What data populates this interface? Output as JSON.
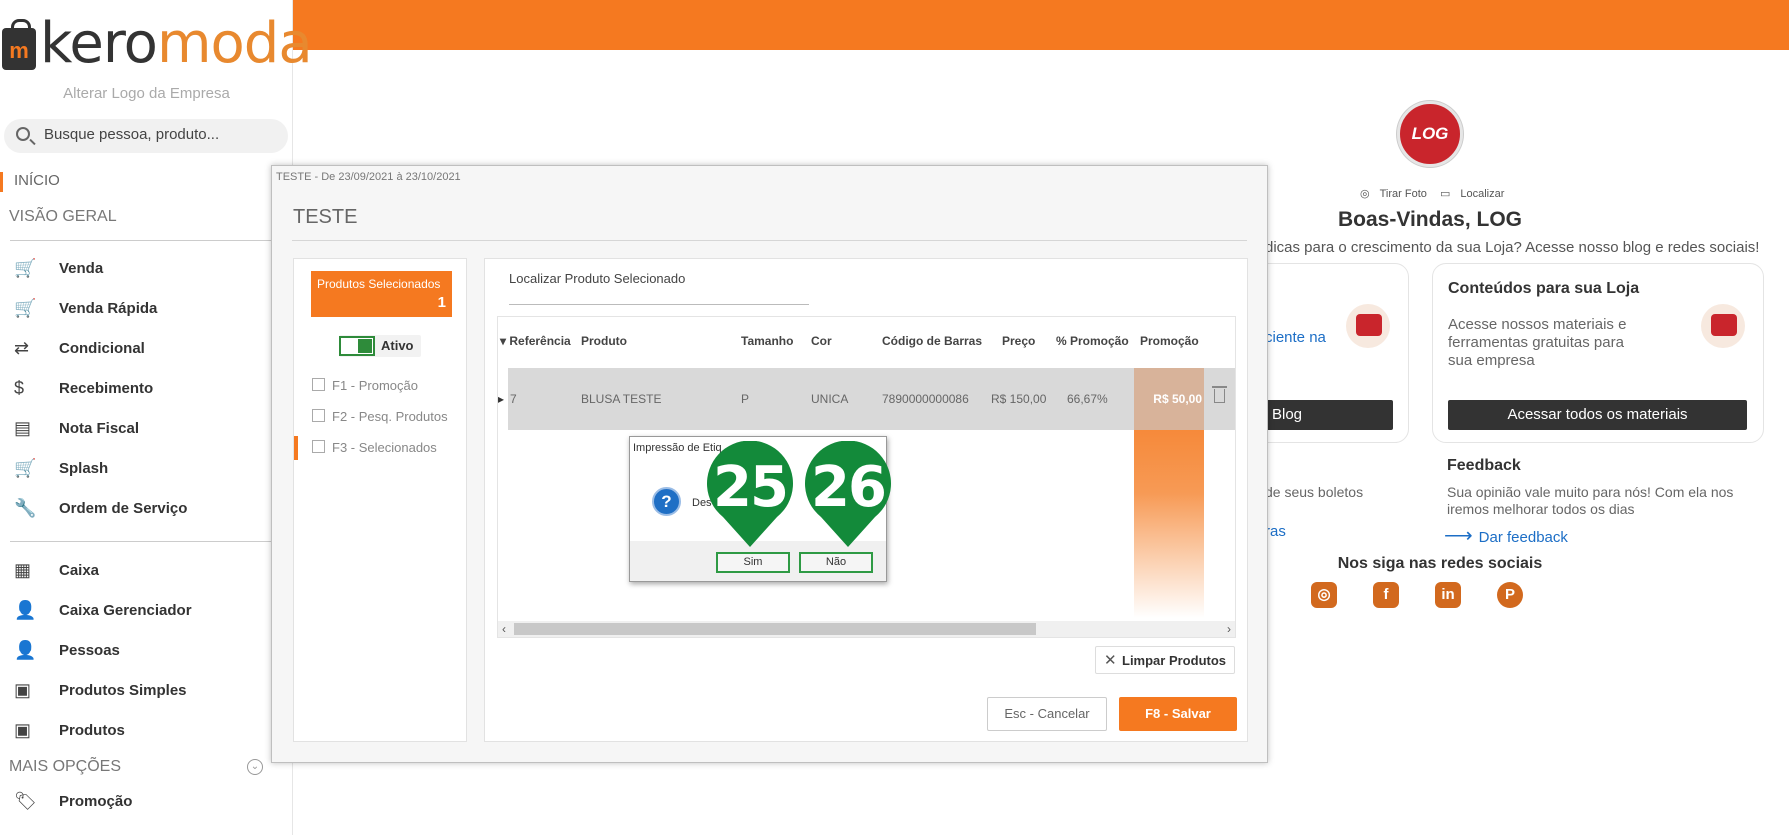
{
  "brand": {
    "logo_part1": "kero",
    "logo_part2": "moda",
    "logo_icon_letter": "m",
    "alterar_logo": "Alterar Logo da Empresa"
  },
  "search": {
    "placeholder": "Busque pessoa, produto..."
  },
  "sidebar": {
    "inicio": "INÍCIO",
    "visao_geral": "VISÃO GERAL",
    "items_main": [
      {
        "label": "Venda",
        "icon": "cart-icon"
      },
      {
        "label": "Venda Rápida",
        "icon": "cart-fast-icon"
      },
      {
        "label": "Condicional",
        "icon": "exchange-icon"
      },
      {
        "label": "Recebimento",
        "icon": "hand-money-icon"
      },
      {
        "label": "Nota Fiscal",
        "icon": "nfe-icon"
      },
      {
        "label": "Splash",
        "icon": "cart-dollar-icon"
      },
      {
        "label": "Ordem de Serviço",
        "icon": "wrench-icon"
      }
    ],
    "items_secondary": [
      {
        "label": "Caixa",
        "icon": "cash-register-icon"
      },
      {
        "label": "Caixa Gerenciador",
        "icon": "user-settings-icon"
      },
      {
        "label": "Pessoas",
        "icon": "people-icon"
      },
      {
        "label": "Produtos Simples",
        "icon": "box-icon"
      },
      {
        "label": "Produtos",
        "icon": "boxes-icon"
      }
    ],
    "mais_opcoes": "MAIS OPÇÕES",
    "promocao": "Promoção"
  },
  "welcome": {
    "avatar_text": "LOG",
    "tirar_foto": "Tirar Foto",
    "localizar": "Localizar",
    "title": "Boas-Vindas, LOG",
    "tagline": "dicas para o crescimento da sua Loja? Acesse nosso blog e redes sociais!",
    "card1_partial": "ciente na",
    "card1_btn": "Blog",
    "card2_title": "Conteúdos para sua Loja",
    "card2_desc": "Acesse nossos materiais e ferramentas gratuitas para sua empresa",
    "card2_btn": "Acessar todos os materiais",
    "boletos_partial": "de seus boletos",
    "ras_partial": "ras",
    "feedback_title": "Feedback",
    "feedback_desc": "Sua opinião vale muito para nós! Com ela nos iremos melhorar todos os dias",
    "feedback_link": "Dar feedback",
    "social_title": "Nos siga nas redes sociais"
  },
  "modal": {
    "window_title": "TESTE - De 23/09/2021 à 23/10/2021",
    "title": "TESTE",
    "produtos_selecionados_label": "Produtos Selecionados",
    "produtos_selecionados_count": "1",
    "toggle_label": "Ativo",
    "nav": [
      "F1 - Promoção",
      "F2 - Pesq. Produtos",
      "F3 - Selecionados"
    ],
    "localizar_label": "Localizar Produto Selecionado",
    "columns": [
      "Referência",
      "Produto",
      "Tamanho",
      "Cor",
      "Código de Barras",
      "Preço",
      "% Promoção",
      "Promoção"
    ],
    "row": {
      "referencia": "7",
      "produto": "BLUSA TESTE",
      "tamanho": "P",
      "cor": "UNICA",
      "codigo": "7890000000086",
      "preco": "R$ 150,00",
      "pct": "66,67%",
      "promocao": "R$ 50,00"
    },
    "limpar": "Limpar Produtos",
    "cancel": "Esc - Cancelar",
    "save": "F8 - Salvar"
  },
  "dialog": {
    "title": "Impressão de Etiq",
    "message": "Des                   as e",
    "sim": "Sim",
    "nao": "Não"
  },
  "markers": {
    "m1": "25",
    "m2": "26"
  }
}
